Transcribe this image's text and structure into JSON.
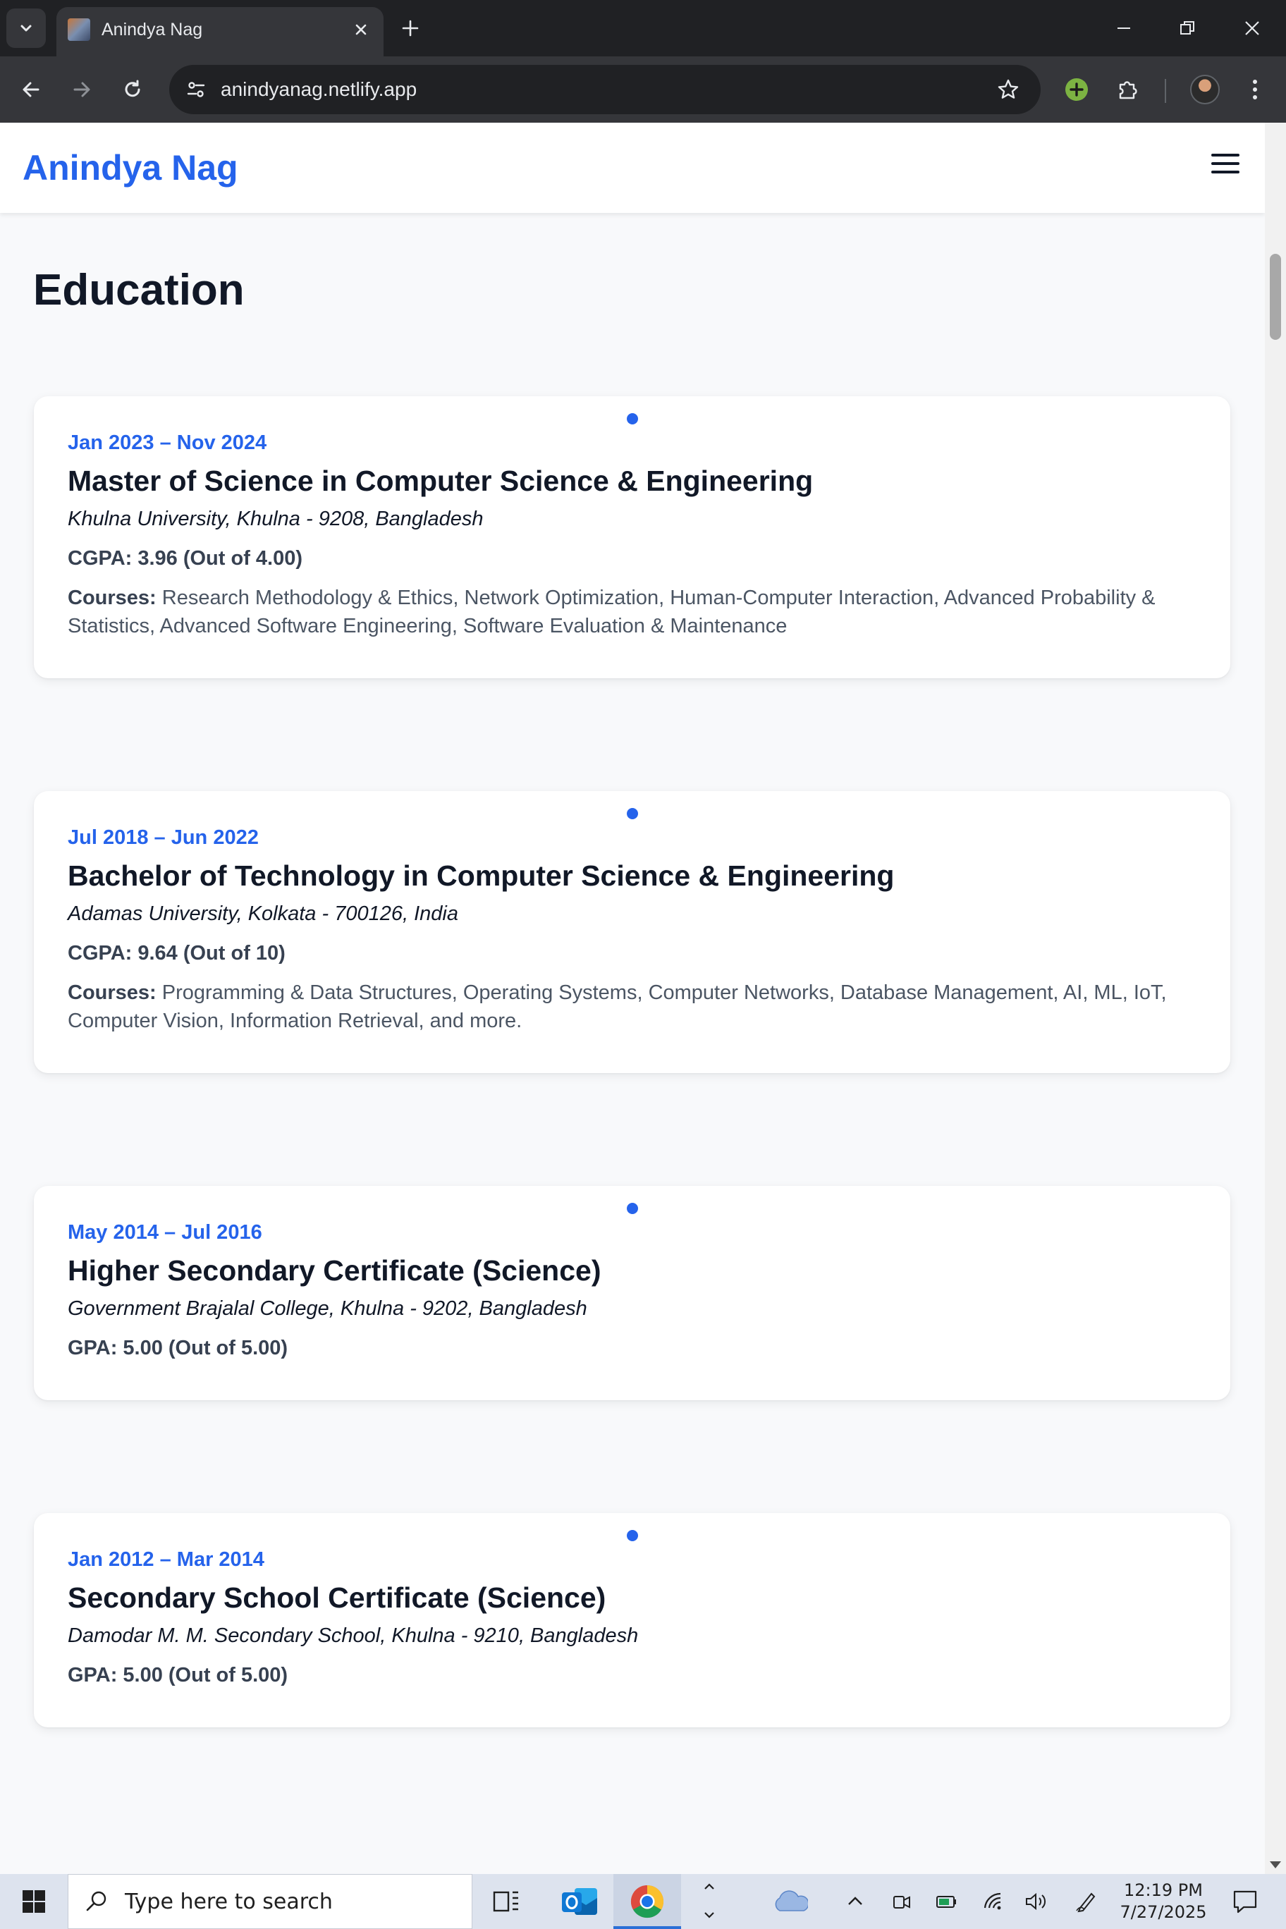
{
  "browser": {
    "tab_title": "Anindya Nag",
    "url": "anindyanag.netlify.app"
  },
  "site": {
    "brand": "Anindya Nag",
    "section_title": "Education",
    "education": [
      {
        "date": "Jan 2023 – Nov 2024",
        "degree": "Master of Science in Computer Science & Engineering",
        "school": "Khulna University, Khulna - 9208, Bangladesh",
        "grade": "CGPA: 3.96 (Out of 4.00)",
        "courses_label": "Courses:",
        "courses": " Research Methodology & Ethics, Network Optimization, Human-Computer Interaction, Advanced Probability & Statistics, Advanced Software Engineering, Software Evaluation & Maintenance"
      },
      {
        "date": "Jul 2018 – Jun 2022",
        "degree": "Bachelor of Technology in Computer Science & Engineering",
        "school": "Adamas University, Kolkata - 700126, India",
        "grade": "CGPA: 9.64 (Out of 10)",
        "courses_label": "Courses:",
        "courses": " Programming & Data Structures, Operating Systems, Computer Networks, Database Management, AI, ML, IoT, Computer Vision, Information Retrieval, and more."
      },
      {
        "date": "May 2014 – Jul 2016",
        "degree": "Higher Secondary Certificate (Science)",
        "school": "Government Brajalal College, Khulna - 9202, Bangladesh",
        "grade": "GPA: 5.00 (Out of 5.00)"
      },
      {
        "date": "Jan 2012 – Mar 2014",
        "degree": "Secondary School Certificate (Science)",
        "school": "Damodar M. M. Secondary School, Khulna - 9210, Bangladesh",
        "grade": "GPA: 5.00 (Out of 5.00)"
      }
    ]
  },
  "taskbar": {
    "search_placeholder": "Type here to search",
    "time": "12:19 PM",
    "date": "7/27/2025"
  },
  "colors": {
    "accent": "#2563eb",
    "heading": "#111827",
    "page_bg": "#f8f9fb",
    "chrome_dark": "#202124",
    "chrome_toolbar": "#35363a"
  },
  "icons": {
    "tab_search": "chevron-down-icon",
    "tab_close": "close-icon",
    "new_tab": "plus-icon",
    "back": "arrow-left-icon",
    "forward": "arrow-right-icon",
    "reload": "reload-icon",
    "site_info": "tune-icon",
    "bookmark": "star-icon",
    "extensions": "puzzle-icon",
    "menu": "kebab-menu-icon",
    "nav_menu": "hamburger-icon"
  }
}
